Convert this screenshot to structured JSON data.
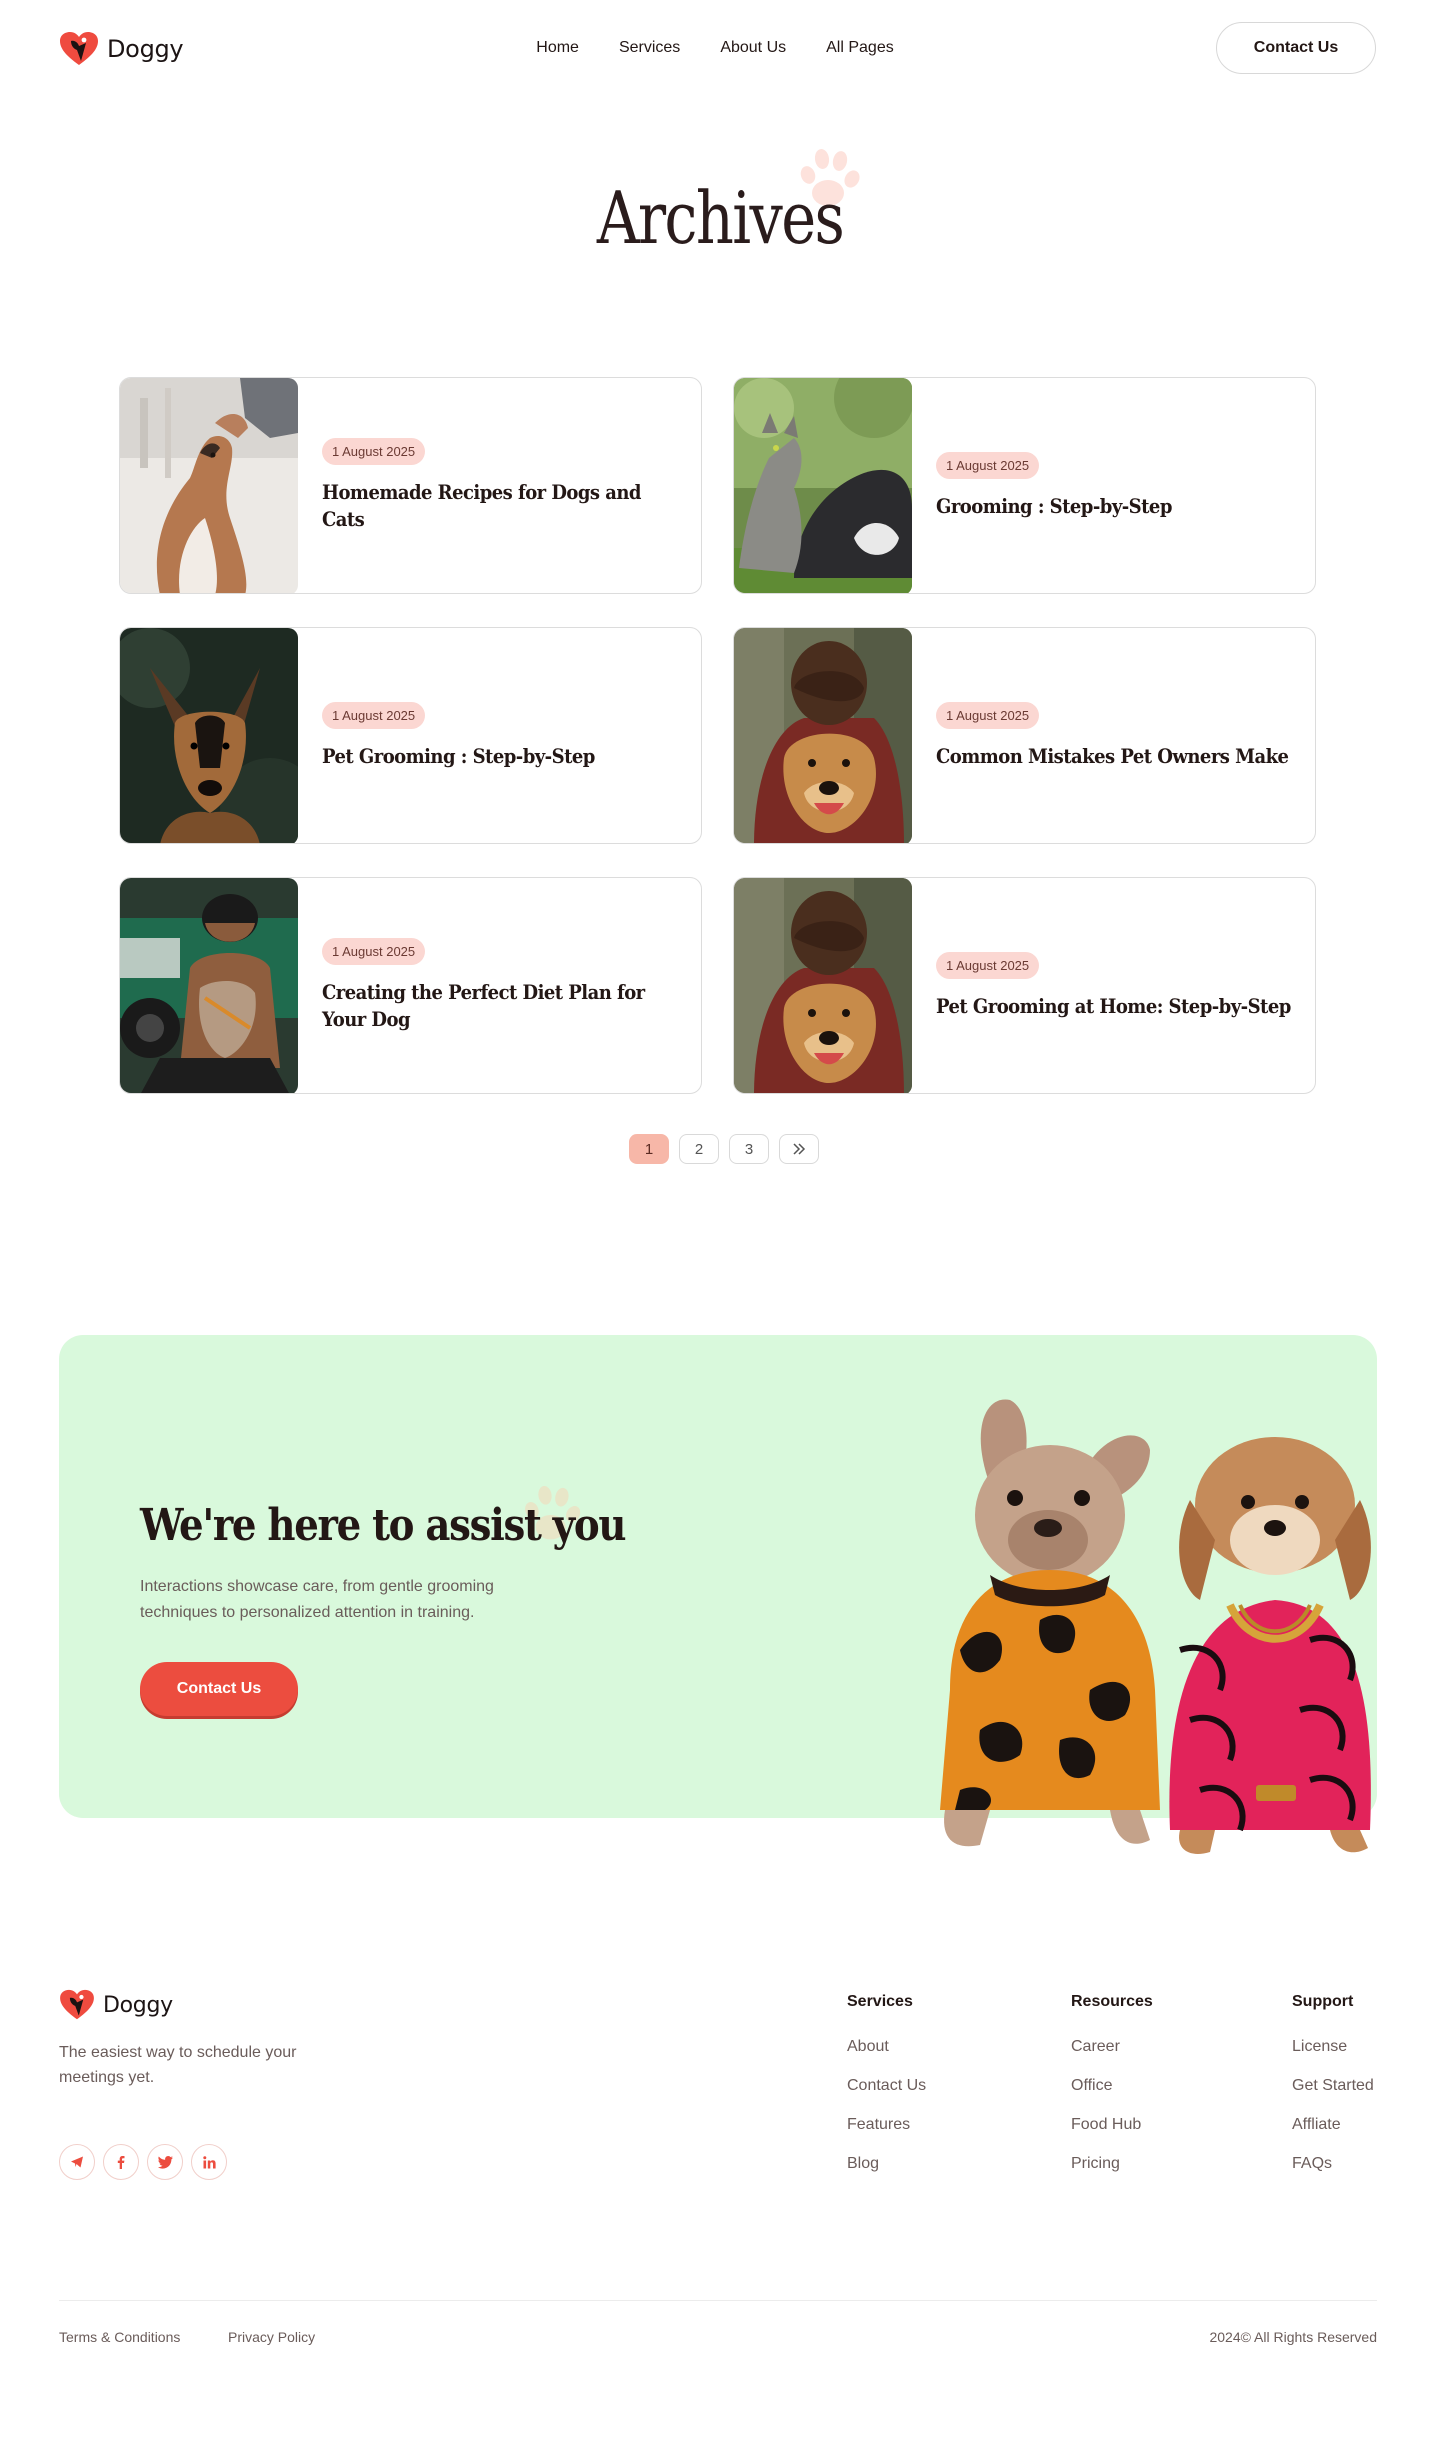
{
  "brand": {
    "name": "Doggy",
    "accent": "#ec4d3f",
    "badge_bg": "#fbd7d2",
    "cta_bg": "#d9f9dc"
  },
  "nav": {
    "items": [
      "Home",
      "Services",
      "About Us",
      "All Pages"
    ],
    "contact_label": "Contact Us"
  },
  "hero": {
    "title": "Archives"
  },
  "posts": [
    {
      "date": "1 August 2025",
      "title": "Homemade Recipes for Dogs and Cats",
      "image": "dog-treat-photo"
    },
    {
      "date": "1 August 2025",
      "title": "Grooming : Step-by-Step",
      "image": "cat-and-dog-photo"
    },
    {
      "date": "1 August 2025",
      "title": "Pet Grooming : Step-by-Step",
      "image": "german-shepherd-photo"
    },
    {
      "date": "1 August 2025",
      "title": "Common Mistakes Pet Owners Make",
      "image": "man-hugging-dog-photo"
    },
    {
      "date": "1 August 2025",
      "title": "Creating the Perfect Diet Plan for Your Dog",
      "image": "man-with-dog-photo"
    },
    {
      "date": "1 August 2025",
      "title": "Pet Grooming at Home: Step-by-Step",
      "image": "man-hugging-dog-photo"
    }
  ],
  "pagination": {
    "pages": [
      "1",
      "2",
      "3"
    ],
    "current": "1",
    "next_icon": "double-chevron-right-icon"
  },
  "cta": {
    "title": "We're here to assist you",
    "text": "Interactions showcase care, from gentle grooming techniques to personalized attention in training.",
    "button": "Contact Us"
  },
  "footer": {
    "tagline": "The easiest way to schedule your meetings yet.",
    "socials": [
      "telegram-icon",
      "facebook-icon",
      "twitter-icon",
      "linkedin-icon"
    ],
    "columns": [
      {
        "title": "Services",
        "links": [
          "About",
          "Contact Us",
          "Features",
          "Blog"
        ]
      },
      {
        "title": "Resources",
        "links": [
          "Career",
          "Office",
          "Food Hub",
          "Pricing"
        ]
      },
      {
        "title": "Support",
        "links": [
          "License",
          "Get Started",
          "Affliate",
          "FAQs"
        ]
      }
    ],
    "terms": "Terms & Conditions",
    "privacy": "Privacy Policy",
    "copyright": "2024© All Rights Reserved"
  }
}
